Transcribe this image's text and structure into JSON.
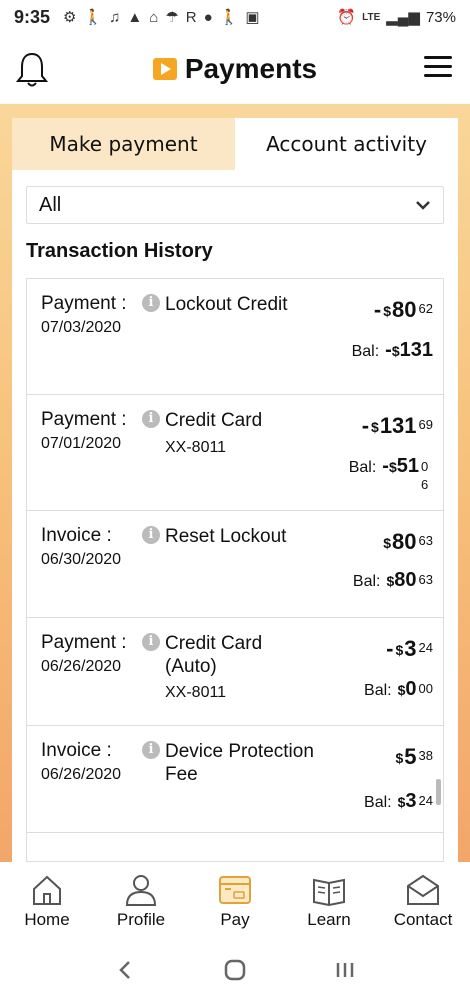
{
  "status_bar": {
    "time": "9:35",
    "carrier_letter": "R",
    "network": "LTE",
    "battery": "73%"
  },
  "header": {
    "title": "Payments"
  },
  "tabs": [
    {
      "label": "Make payment",
      "active": false
    },
    {
      "label": "Account activity",
      "active": true
    }
  ],
  "filter": {
    "selected": "All"
  },
  "section_title": "Transaction History",
  "transactions": [
    {
      "type": "Payment :",
      "date": "07/03/2020",
      "description": "Lockout Credit",
      "sub": "",
      "amount_sign": "-",
      "amount_dollars": "80",
      "amount_cents": "62",
      "balance_sign": "-",
      "balance_dollars": "131",
      "balance_cents": ""
    },
    {
      "type": "Payment :",
      "date": "07/01/2020",
      "description": "Credit Card",
      "sub": "XX-8011",
      "amount_sign": "-",
      "amount_dollars": "131",
      "amount_cents": "69",
      "balance_sign": "-",
      "balance_dollars": "51",
      "balance_cents": "06"
    },
    {
      "type": "Invoice :",
      "date": "06/30/2020",
      "description": "Reset Lockout",
      "sub": "",
      "amount_sign": "",
      "amount_dollars": "80",
      "amount_cents": "63",
      "balance_sign": "",
      "balance_dollars": "80",
      "balance_cents": "63"
    },
    {
      "type": "Payment :",
      "date": "06/26/2020",
      "description": "Credit Card (Auto)",
      "sub": "XX-8011",
      "amount_sign": "-",
      "amount_dollars": "3",
      "amount_cents": "24",
      "balance_sign": "",
      "balance_dollars": "0",
      "balance_cents": "00"
    },
    {
      "type": "Invoice :",
      "date": "06/26/2020",
      "description": "Device Protection Fee",
      "sub": "",
      "amount_sign": "",
      "amount_dollars": "5",
      "amount_cents": "38",
      "balance_sign": "",
      "balance_dollars": "3",
      "balance_cents": "24"
    }
  ],
  "labels": {
    "balance": "Bal:",
    "currency": "$",
    "info": "i"
  },
  "bottom_nav": [
    {
      "label": "Home",
      "icon": "home-icon"
    },
    {
      "label": "Profile",
      "icon": "profile-icon"
    },
    {
      "label": "Pay",
      "icon": "pay-icon",
      "active": true
    },
    {
      "label": "Learn",
      "icon": "learn-icon"
    },
    {
      "label": "Contact",
      "icon": "contact-icon"
    }
  ],
  "colors": {
    "accent": "#f5a623",
    "tab_inactive": "#fbe6c6",
    "gradient_top": "#f9d79a",
    "gradient_bottom": "#f3a66a"
  }
}
